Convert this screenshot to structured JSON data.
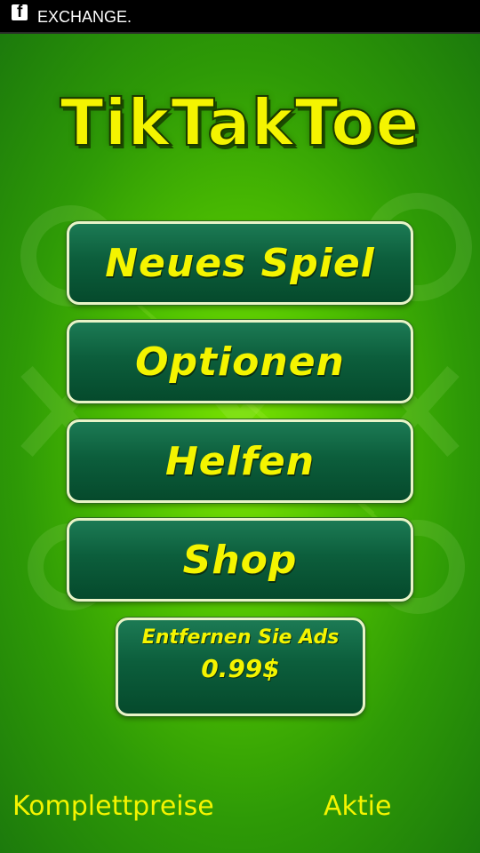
{
  "ad_bar": {
    "icon": "facebook-icon",
    "text": "EXCHANGE."
  },
  "title": "TikTakToe",
  "menu": {
    "new_game": "Neues Spiel",
    "options": "Optionen",
    "help": "Helfen",
    "shop": "Shop"
  },
  "remove_ads": {
    "label": "Entfernen Sie Ads",
    "price": "0.99$"
  },
  "footer": {
    "left": "Komplettpreise",
    "right": "Aktie"
  },
  "colors": {
    "title_yellow": "#f4f400",
    "button_dark_green": "#0c5e3c",
    "background_green": "#52c400",
    "button_border": "#e9f4c8"
  }
}
